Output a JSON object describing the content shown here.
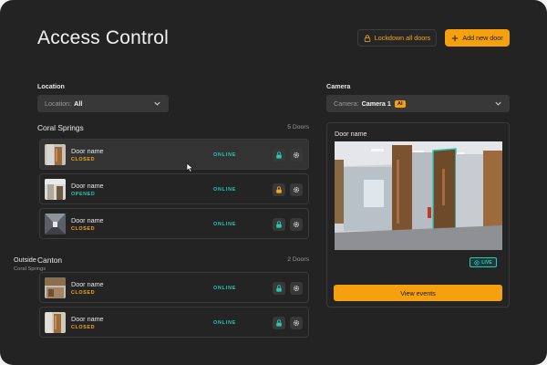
{
  "header": {
    "title": "Access Control",
    "lockdown_label": "Lockdown all doors",
    "add_label": "Add new door"
  },
  "filters": {
    "location_label": "Location",
    "location_prefix": "Location:",
    "location_value": "All",
    "camera_label": "Camera",
    "camera_prefix": "Camera:",
    "camera_value": "Camera 1",
    "camera_badge": "AI"
  },
  "groups": [
    {
      "name": "Coral Springs",
      "count": "5 Doors",
      "doors": [
        {
          "name": "Door name",
          "state": "CLOSED",
          "status": "ONLINE"
        },
        {
          "name": "Door name",
          "state": "OPENED",
          "status": "ONLINE"
        },
        {
          "name": "Door name",
          "state": "CLOSED",
          "status": "ONLINE"
        }
      ]
    },
    {
      "name": "Canton",
      "count": "2 Doors",
      "doors": [
        {
          "name": "Door name",
          "state": "CLOSED",
          "status": "ONLINE"
        },
        {
          "name": "Door name",
          "state": "CLOSED",
          "status": "ONLINE"
        }
      ]
    }
  ],
  "camera_panel": {
    "title": "Door name",
    "location": "Outside",
    "sublocation": "Coral Springs",
    "live_label": "LIVE",
    "events_label": "View events"
  },
  "colors": {
    "accent": "#f5a00f",
    "online": "#27c8b6",
    "background": "#232323"
  },
  "icons": [
    "lock-icon",
    "plus-icon",
    "chevron-down-icon",
    "unlock-icon",
    "gear-icon",
    "live-icon",
    "cursor-icon"
  ]
}
